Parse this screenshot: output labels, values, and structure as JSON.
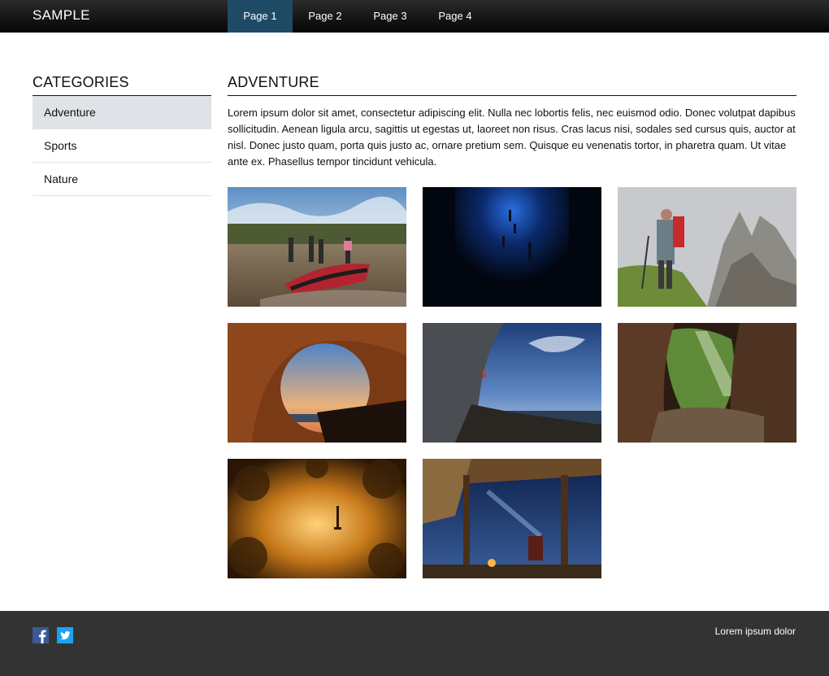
{
  "header": {
    "logo": "SAMPLE",
    "nav": [
      {
        "label": "Page 1",
        "active": true
      },
      {
        "label": "Page 2",
        "active": false
      },
      {
        "label": "Page 3",
        "active": false
      },
      {
        "label": "Page 4",
        "active": false
      }
    ]
  },
  "sidebar": {
    "title": "CATEGORIES",
    "items": [
      {
        "label": "Adventure",
        "active": true
      },
      {
        "label": "Sports",
        "active": false
      },
      {
        "label": "Nature",
        "active": false
      }
    ]
  },
  "main": {
    "title": "ADVENTURE",
    "text": "Lorem ipsum dolor sit amet, consectetur adipiscing elit. Nulla nec lobortis felis, nec euismod odio. Donec volutpat dapibus sollicitudin. Aenean ligula arcu, sagittis ut egestas ut, laoreet non risus. Cras lacus nisi, sodales sed cursus quis, auctor at nisl. Donec justo quam, porta quis justo ac, ornare pretium sem. Quisque eu venenatis tortor, in pharetra quam. Ut vitae ante ex. Phasellus tempor tincidunt vehicula.",
    "photos": [
      {
        "name": "photo-river-raft"
      },
      {
        "name": "photo-underwater-divers"
      },
      {
        "name": "photo-mountain-hiker"
      },
      {
        "name": "photo-cave-sunset-climber"
      },
      {
        "name": "photo-sea-cliff-climber"
      },
      {
        "name": "photo-jungle-cave"
      },
      {
        "name": "photo-golden-reflection"
      },
      {
        "name": "photo-night-shelter"
      }
    ]
  },
  "footer": {
    "text": "Lorem ipsum dolor",
    "social": [
      "facebook-icon",
      "twitter-icon"
    ]
  },
  "colors": {
    "nav_active": "#1f4a66",
    "sidebar_active": "#dfe2e6",
    "footer_bg": "#333333",
    "facebook": "#3b5998",
    "twitter": "#1da1f2"
  }
}
